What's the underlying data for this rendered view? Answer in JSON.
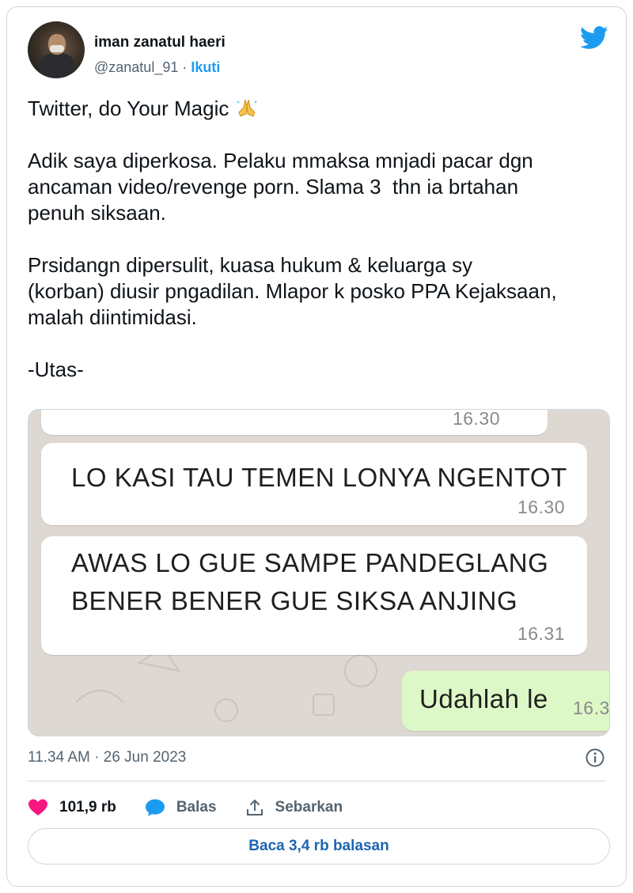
{
  "author": {
    "name": "iman zanatul haeri",
    "handle": "@zanatul_91",
    "separator": " · ",
    "follow_label": "Ikuti"
  },
  "icons": {
    "logo": "twitter-bird-icon",
    "emoji": "folded-hands-icon",
    "info": "info-icon",
    "like": "heart-icon",
    "reply": "speech-bubble-icon",
    "share": "share-upload-icon"
  },
  "colors": {
    "brand": "#1d9bf0",
    "like": "#f91880",
    "chat_bg": "#ddd8d1",
    "outgoing_bubble": "#dcf8c6"
  },
  "tweet": {
    "line1": "Twitter, do Your Magic ",
    "body": "\n\nAdik saya diperkosa. Pelaku mmaksa mnjadi pacar dgn\nancaman video/revenge porn. Slama 3  thn ia brtahan\npenuh siksaan.\n\nPrsidangn dipersulit, kuasa hukum & keluarga sy\n(korban) diusir pngadilan. Mlapor k posko PPA Kejaksaan,\nmalah diintimidasi.\n\n-Utas-"
  },
  "chat": {
    "messages": [
      {
        "text": "",
        "time": "16.30"
      },
      {
        "text": "LO KASI TAU TEMEN LONYA NGENTOT",
        "time": "16.30"
      },
      {
        "text": "AWAS LO GUE SAMPE PANDEGLANG\nBENER BENER GUE SIKSA ANJING",
        "time": "16.31"
      },
      {
        "text": "Udahlah le",
        "time": "16.3"
      }
    ]
  },
  "meta": {
    "timestamp": "11.34 AM · 26 Jun 2023"
  },
  "actions": {
    "likes": "101,9 rb",
    "reply_label": "Balas",
    "share_label": "Sebarkan"
  },
  "read_replies_label": "Baca 3,4 rb balasan"
}
